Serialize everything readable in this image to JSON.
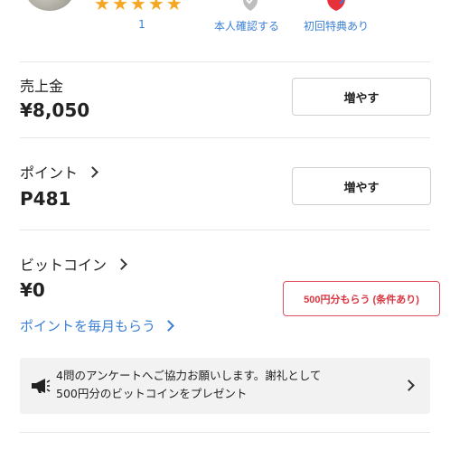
{
  "profile": {
    "rating_stars": 5,
    "rating_count": "1",
    "verify_label": "本人確認する",
    "first_bonus_label": "初回特典あり"
  },
  "sales": {
    "title": "売上金",
    "amount": "¥8,050",
    "button_label": "増やす"
  },
  "points": {
    "title": "ポイント",
    "amount": "P481",
    "button_label": "増やす"
  },
  "bitcoin": {
    "title": "ビットコイン",
    "amount": "¥0",
    "promo_label": "500円分もらう (条件あり)"
  },
  "monthly_link": {
    "label": "ポイントを毎月もらう"
  },
  "notice": {
    "line1": "4問のアンケートへご協力お願いします。謝礼として",
    "line2": "500円分のビットコインをプレゼント"
  },
  "colors": {
    "link": "#3b7fd4",
    "star": "#f5a623",
    "promo": "#d9343f"
  }
}
